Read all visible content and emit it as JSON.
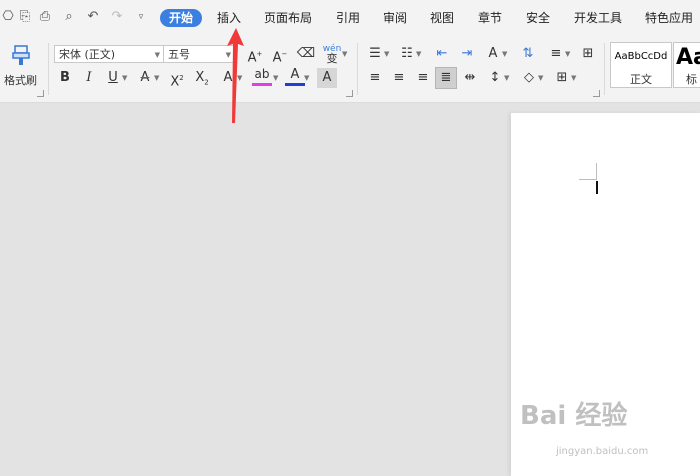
{
  "tabs": [
    "开始",
    "插入",
    "页面布局",
    "引用",
    "审阅",
    "视图",
    "章节",
    "安全",
    "开发工具",
    "特色应用"
  ],
  "quick_access": [
    "open-icon",
    "copy-icon",
    "print-icon",
    "preview-icon",
    "undo-icon",
    "redo-icon",
    "customize-icon"
  ],
  "ribbon": {
    "format_painter_label": "格式刷",
    "font_name": "宋体 (正文)",
    "font_size": "五号",
    "phonetic_label": "wén",
    "styles": [
      {
        "sample": "AaBbCcDd",
        "label": "正文"
      },
      {
        "sample": "Aa",
        "label": "标"
      }
    ]
  },
  "colors": {
    "active_tab": "#3b7fe0",
    "annotation_arrow": "#f03a3a",
    "font_color": "#1f3fd6",
    "highlight_color": "#e040e0"
  },
  "watermark": {
    "brand": "Bai 经验",
    "url": "jingyan.baidu.com"
  }
}
